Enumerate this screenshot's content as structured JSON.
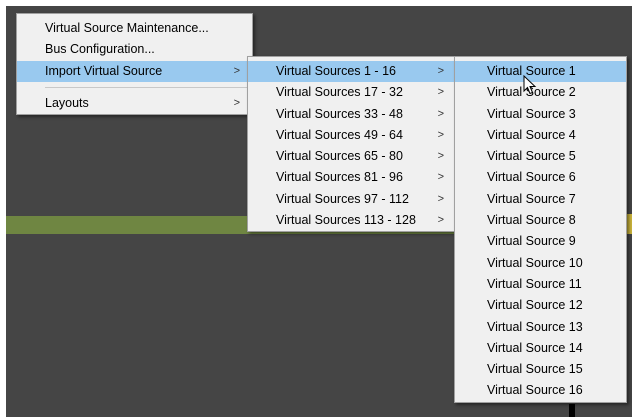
{
  "main_menu": {
    "items": [
      {
        "label": "Virtual Source Maintenance..."
      },
      {
        "label": "Bus Configuration..."
      },
      {
        "label": "Import Virtual Source",
        "arrow": ">"
      },
      {
        "label": "Layouts",
        "arrow": ">"
      }
    ]
  },
  "import_submenu": {
    "items": [
      {
        "label": "Virtual Sources 1 - 16",
        "arrow": ">"
      },
      {
        "label": "Virtual Sources 17 - 32",
        "arrow": ">"
      },
      {
        "label": "Virtual Sources 33 - 48",
        "arrow": ">"
      },
      {
        "label": "Virtual Sources 49 - 64",
        "arrow": ">"
      },
      {
        "label": "Virtual Sources 65 - 80",
        "arrow": ">"
      },
      {
        "label": "Virtual Sources 81 - 96",
        "arrow": ">"
      },
      {
        "label": "Virtual Sources 97 - 112",
        "arrow": ">"
      },
      {
        "label": "Virtual Sources 113 - 128",
        "arrow": ">"
      }
    ]
  },
  "sources_submenu": {
    "items": [
      "Virtual Source 1",
      "Virtual Source 2",
      "Virtual Source 3",
      "Virtual Source 4",
      "Virtual Source 5",
      "Virtual Source 6",
      "Virtual Source 7",
      "Virtual Source 8",
      "Virtual Source 9",
      "Virtual Source 10",
      "Virtual Source 11",
      "Virtual Source 12",
      "Virtual Source 13",
      "Virtual Source 14",
      "Virtual Source 15",
      "Virtual Source 16"
    ]
  },
  "colors": {
    "background": "#454545",
    "menu_background": "#f0f0f0",
    "highlight": "#99c9ef",
    "band_green": "#6f8642"
  }
}
